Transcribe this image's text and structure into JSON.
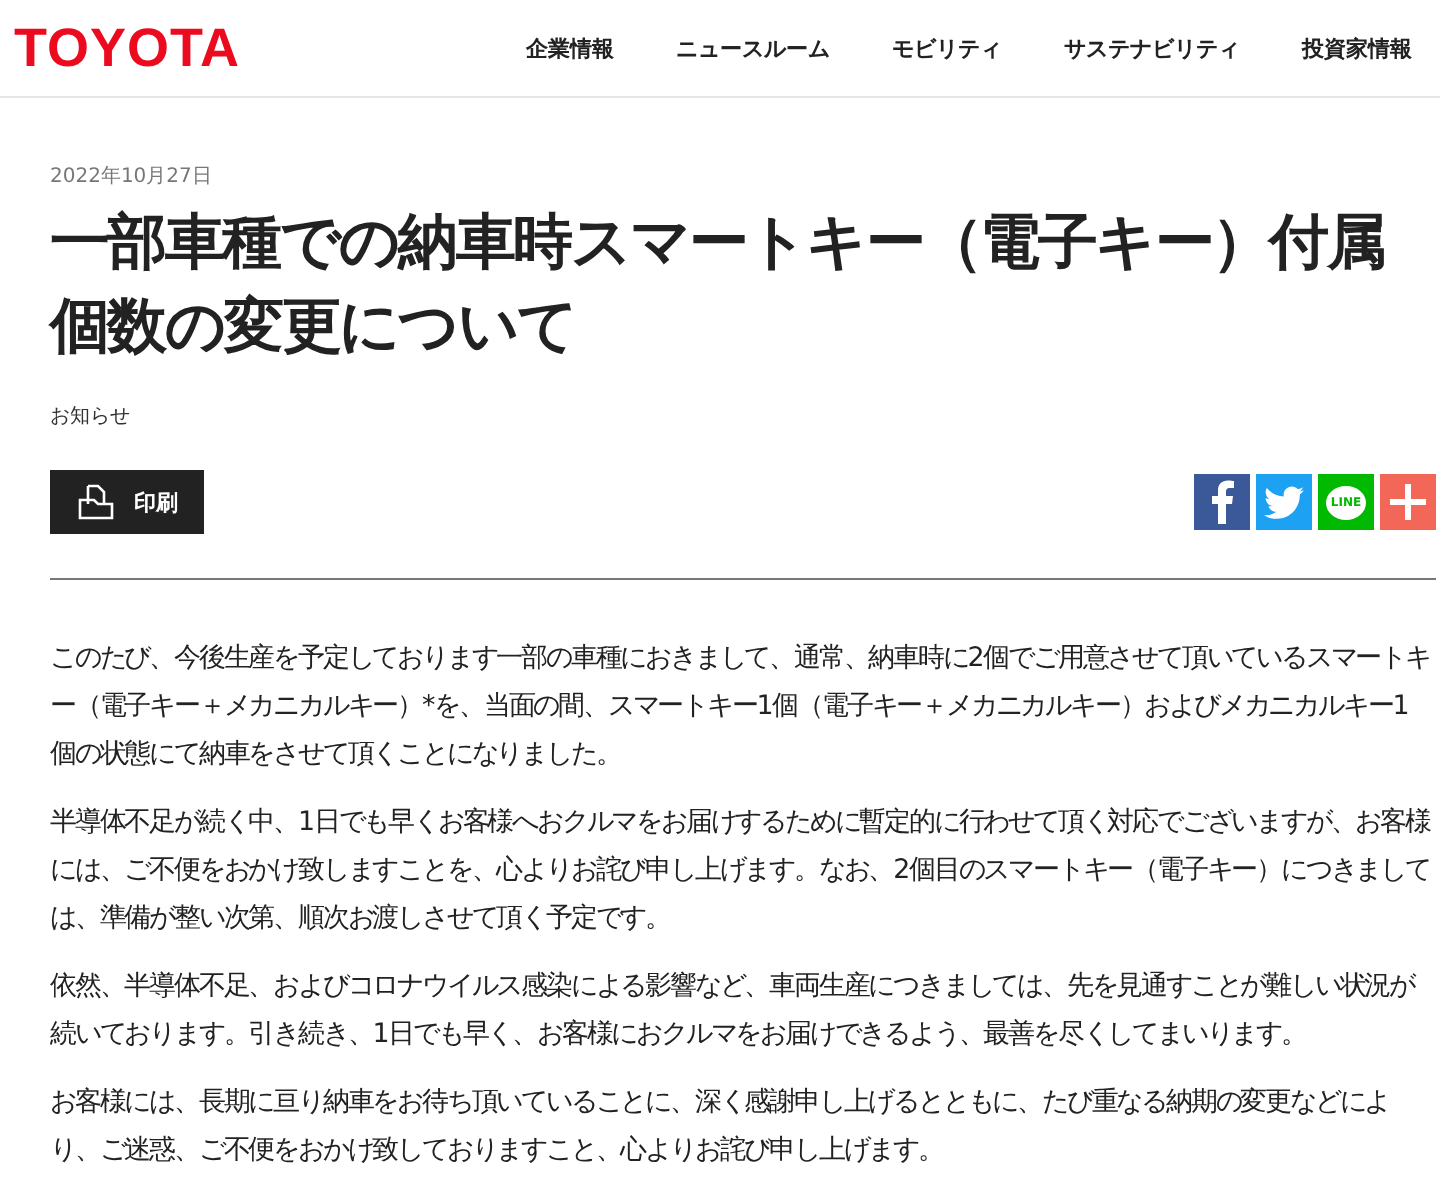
{
  "header": {
    "logo": "TOYOTA",
    "nav": [
      "企業情報",
      "ニュースルーム",
      "モビリティ",
      "サステナビリティ",
      "投資家情報"
    ]
  },
  "article": {
    "date": "2022年10月27日",
    "title": "一部車種での納車時スマートキー（電子キー）付属個数の変更について",
    "category": "お知らせ",
    "print_button": "印刷",
    "share": [
      {
        "kind": "facebook",
        "color": "#3b5998"
      },
      {
        "kind": "twitter",
        "color": "#1da1f2"
      },
      {
        "kind": "line",
        "color": "#00b900",
        "label": "LINE"
      },
      {
        "kind": "more",
        "color": "#f26757"
      }
    ],
    "paragraphs": [
      "このたび、今後生産を予定しております一部の車種におきまして、通常、納車時に2個でご用意させて頂いているスマートキー（電子キー＋メカニカルキー）*を、当面の間、スマートキー1個（電子キー＋メカニカルキー）およびメカニカルキー1個の状態にて納車をさせて頂くことになりました。",
      "半導体不足が続く中、1日でも早くお客様へおクルマをお届けするために暫定的に行わせて頂く対応でございますが、お客様には、ご不便をおかけ致しますことを、心よりお詫び申し上げます。なお、2個目のスマートキー（電子キー）につきましては、準備が整い次第、順次お渡しさせて頂く予定です。",
      "依然、半導体不足、およびコロナウイルス感染による影響など、車両生産につきましては、先を見通すことが難しい状況が続いております。引き続き、1日でも早く、お客様におクルマをお届けできるよう、最善を尽くしてまいります。",
      "お客様には、長期に亘り納車をお待ち頂いていることに、深く感謝申し上げるとともに、たび重なる納期の変更などにより、ご迷惑、ご不便をおかけ致しておりますこと、心よりお詫び申し上げます。"
    ]
  }
}
